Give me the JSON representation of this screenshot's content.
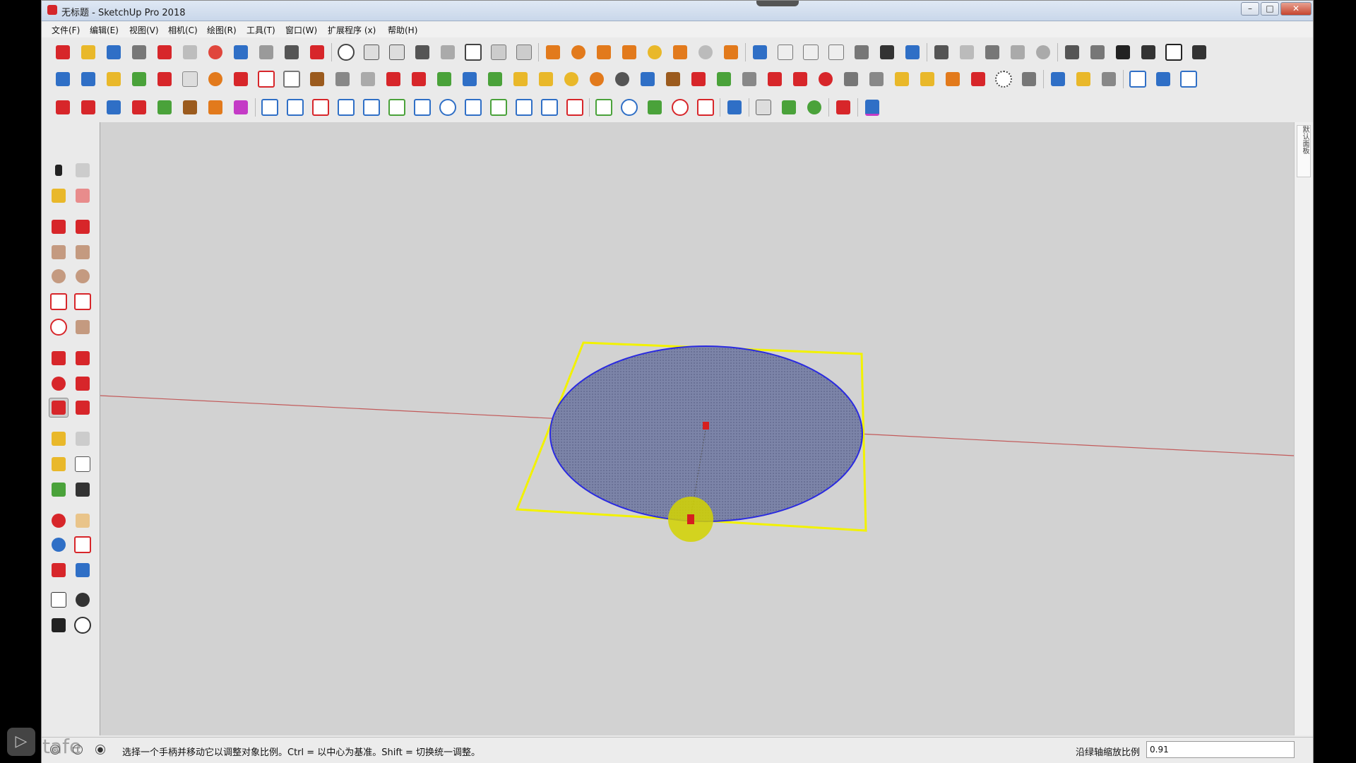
{
  "window": {
    "title": "无标题 - SketchUp Pro 2018",
    "minimize": "–",
    "maximize": "□",
    "close": "✕"
  },
  "menu": [
    {
      "label": "文件(F)"
    },
    {
      "label": "编辑(E)"
    },
    {
      "label": "视图(V)"
    },
    {
      "label": "相机(C)"
    },
    {
      "label": "绘图(R)"
    },
    {
      "label": "工具(T)"
    },
    {
      "label": "窗口(W)"
    },
    {
      "label": "扩展程序 (x)"
    },
    {
      "label": "帮助(H)"
    }
  ],
  "toolbar_colors": {
    "red": "#d7262a",
    "blue": "#2f6fc6",
    "yellow": "#e9b82a",
    "green": "#4aa23a",
    "gray": "#777777",
    "orange": "#e27a1c",
    "magenta": "#c43bc6"
  },
  "right_tray": {
    "tab_label": "默认面板"
  },
  "status": {
    "text": "选择一个手柄并移动它以调整对象比例。Ctrl = 以中心为基准。Shift = 切换统一调整。",
    "measure_label": "沿绿轴缩放比例",
    "measure_value": "0.91"
  },
  "watermark": {
    "text": "tafe"
  }
}
